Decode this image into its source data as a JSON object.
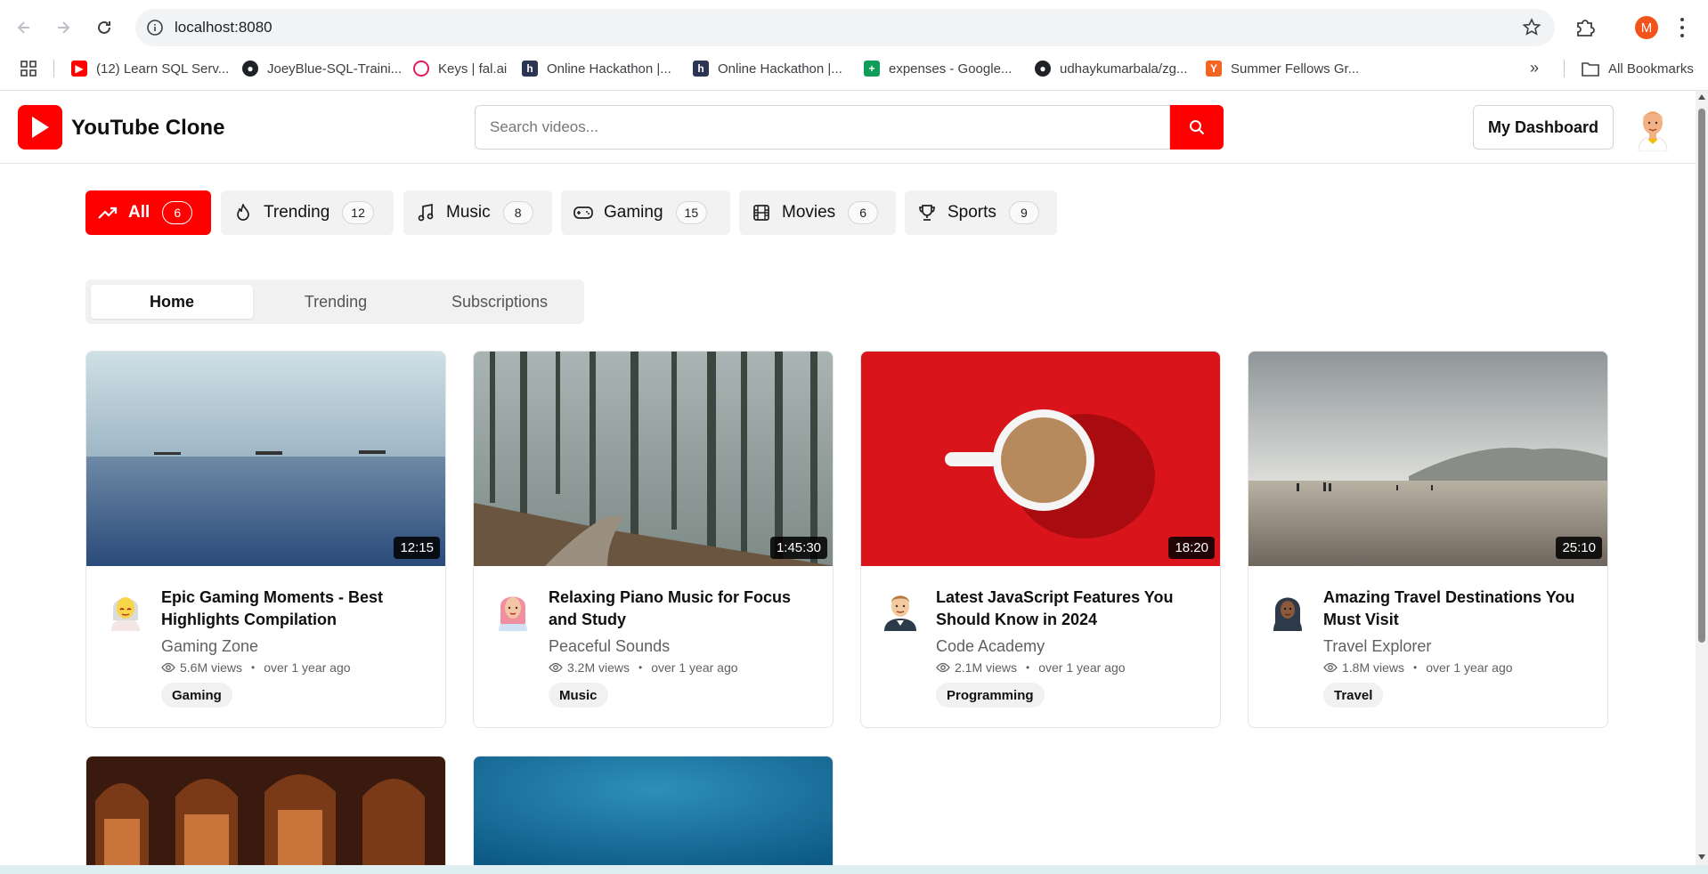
{
  "browser": {
    "url": "localhost:8080",
    "profile_initial": "M",
    "bookmarks": [
      {
        "label": "(12) Learn SQL Serv...",
        "icon": "youtube-icon",
        "color": "#ff0000"
      },
      {
        "label": "JoeyBlue-SQL-Traini...",
        "icon": "github-icon",
        "color": "#1f2328"
      },
      {
        "label": "Keys | fal.ai",
        "icon": "fal-icon",
        "color": "#e5195e"
      },
      {
        "label": "Online Hackathon |...",
        "icon": "hackerearth-icon",
        "color": "#2c3454"
      },
      {
        "label": "Online Hackathon |...",
        "icon": "hackerearth-icon",
        "color": "#2c3454"
      },
      {
        "label": "expenses - Google...",
        "icon": "google-sheets-icon",
        "color": "#0f9d58"
      },
      {
        "label": "udhaykumarbala/zg...",
        "icon": "github-icon",
        "color": "#1f2328"
      },
      {
        "label": "Summer Fellows Gr...",
        "icon": "ycombinator-icon",
        "color": "#f26522"
      }
    ],
    "all_bookmarks_label": "All Bookmarks"
  },
  "header": {
    "app_name": "YouTube Clone",
    "search_placeholder": "Search videos...",
    "dashboard_label": "My Dashboard",
    "brand_color": "#ff0000"
  },
  "categories": [
    {
      "label": "All",
      "count": "6",
      "icon": "trending-up-icon",
      "active": true
    },
    {
      "label": "Trending",
      "count": "12",
      "icon": "flame-icon",
      "active": false
    },
    {
      "label": "Music",
      "count": "8",
      "icon": "music-note-icon",
      "active": false
    },
    {
      "label": "Gaming",
      "count": "15",
      "icon": "gamepad-icon",
      "active": false
    },
    {
      "label": "Movies",
      "count": "6",
      "icon": "film-icon",
      "active": false
    },
    {
      "label": "Sports",
      "count": "9",
      "icon": "trophy-icon",
      "active": false
    }
  ],
  "tabs": [
    {
      "label": "Home",
      "active": true
    },
    {
      "label": "Trending",
      "active": false
    },
    {
      "label": "Subscriptions",
      "active": false
    }
  ],
  "videos": [
    {
      "title": "Epic Gaming Moments - Best Highlights Compilation",
      "channel": "Gaming Zone",
      "views": "5.6M views",
      "age": "over 1 year ago",
      "duration": "12:15",
      "tag": "Gaming",
      "thumb": "sea-with-ships"
    },
    {
      "title": "Relaxing Piano Music for Focus and Study",
      "channel": "Peaceful Sounds",
      "views": "3.2M views",
      "age": "over 1 year ago",
      "duration": "1:45:30",
      "tag": "Music",
      "thumb": "misty-forest-path"
    },
    {
      "title": "Latest JavaScript Features You Should Know in 2024",
      "channel": "Code Academy",
      "views": "2.1M views",
      "age": "over 1 year ago",
      "duration": "18:20",
      "tag": "Programming",
      "thumb": "coffee-cup-on-red"
    },
    {
      "title": "Amazing Travel Destinations You Must Visit",
      "channel": "Travel Explorer",
      "views": "1.8M views",
      "age": "over 1 year ago",
      "duration": "25:10",
      "tag": "Travel",
      "thumb": "beach-with-hills"
    },
    {
      "thumb": "cathedral-arches"
    },
    {
      "thumb": "blue-water"
    }
  ]
}
